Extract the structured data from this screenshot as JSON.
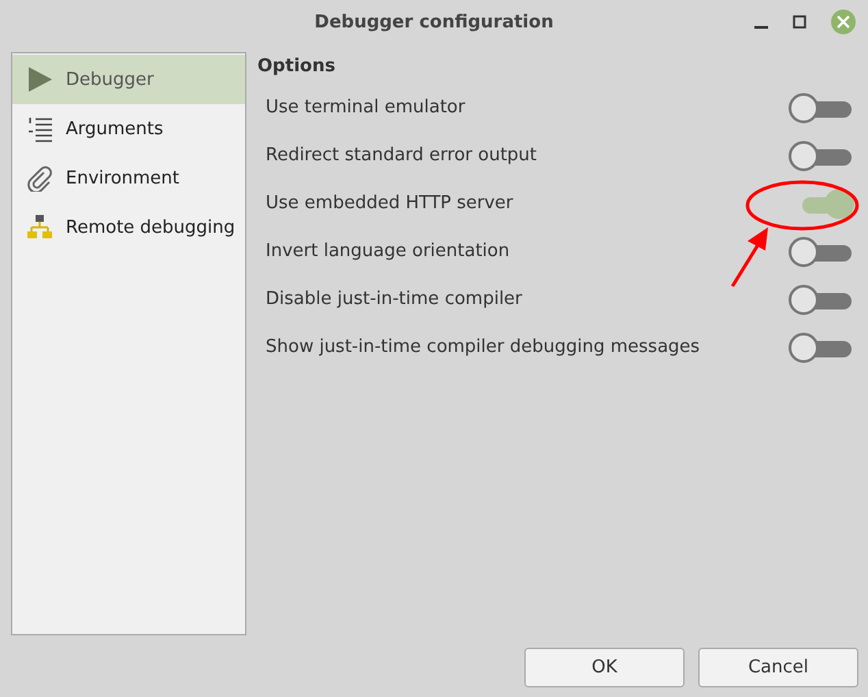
{
  "window": {
    "title": "Debugger configuration"
  },
  "sidebar": {
    "items": [
      {
        "label": "Debugger",
        "kind": "play",
        "selected": true
      },
      {
        "label": "Arguments",
        "kind": "list",
        "selected": false
      },
      {
        "label": "Environment",
        "kind": "clip",
        "selected": false
      },
      {
        "label": "Remote debugging",
        "kind": "network",
        "selected": false
      }
    ]
  },
  "section": {
    "title": "Options"
  },
  "options": [
    {
      "label": "Use terminal emulator",
      "on": false
    },
    {
      "label": "Redirect standard error output",
      "on": false
    },
    {
      "label": "Use embedded HTTP server",
      "on": true,
      "disabled": true
    },
    {
      "label": "Invert language orientation",
      "on": false
    },
    {
      "label": "Disable just-in-time compiler",
      "on": false
    },
    {
      "label": "Show just-in-time compiler debugging messages",
      "on": false
    }
  ],
  "buttons": [
    "OK",
    "Cancel"
  ]
}
